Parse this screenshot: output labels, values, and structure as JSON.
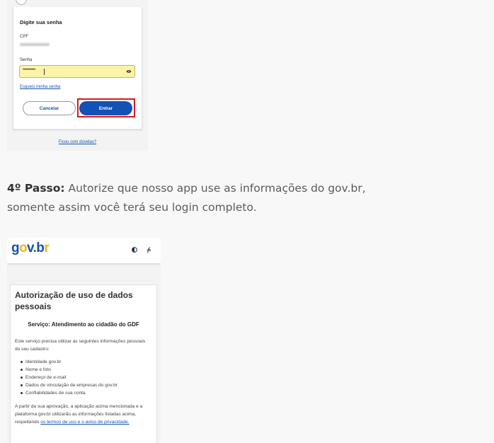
{
  "login": {
    "title": "Digite sua senha",
    "cpf_label": "CPF",
    "password_label": "Senha",
    "password_value": "••••••••••",
    "forgot_link": "Esqueci minha senha",
    "cancel_button": "Cancelar",
    "enter_button": "Entrar",
    "help_link": "Ficou com dúvidas?",
    "highlight_color": "#d9181f",
    "accent_color": "#1351b4",
    "input_fill_color": "#fbf4a8",
    "eye_icon": "eye-icon"
  },
  "step": {
    "label": "4º Passo:",
    "text": " Autorize que nosso app use as informações do gov.br, somente assim você terá seu login completo."
  },
  "auth": {
    "logo": {
      "g": "g",
      "o": "o",
      "v": "v",
      "dot": ".",
      "b": "b",
      "r": "r"
    },
    "header_icons": [
      "contrast-icon",
      "vlibras-icon"
    ],
    "title": "Autorização de uso de dados pessoais",
    "service": "Serviço: Atendimento ao cidadão do GDF",
    "intro": "Este serviço precisa utilizar as seguintes informações pessoais do seu cadastro:",
    "items": [
      "Identidade gov.br",
      "Nome e foto",
      "Endereço de e-mail",
      "Dados de vinculação de empresas do gov.br",
      "Confiabilidades de sua conta"
    ],
    "approval_text": "A partir da sua aprovação, a aplicação acima mencionada e a plataforma gov.br utilizarão as informações listadas acima, respeitando ",
    "terms_link": "os termos de uso e o aviso de privacidade."
  }
}
